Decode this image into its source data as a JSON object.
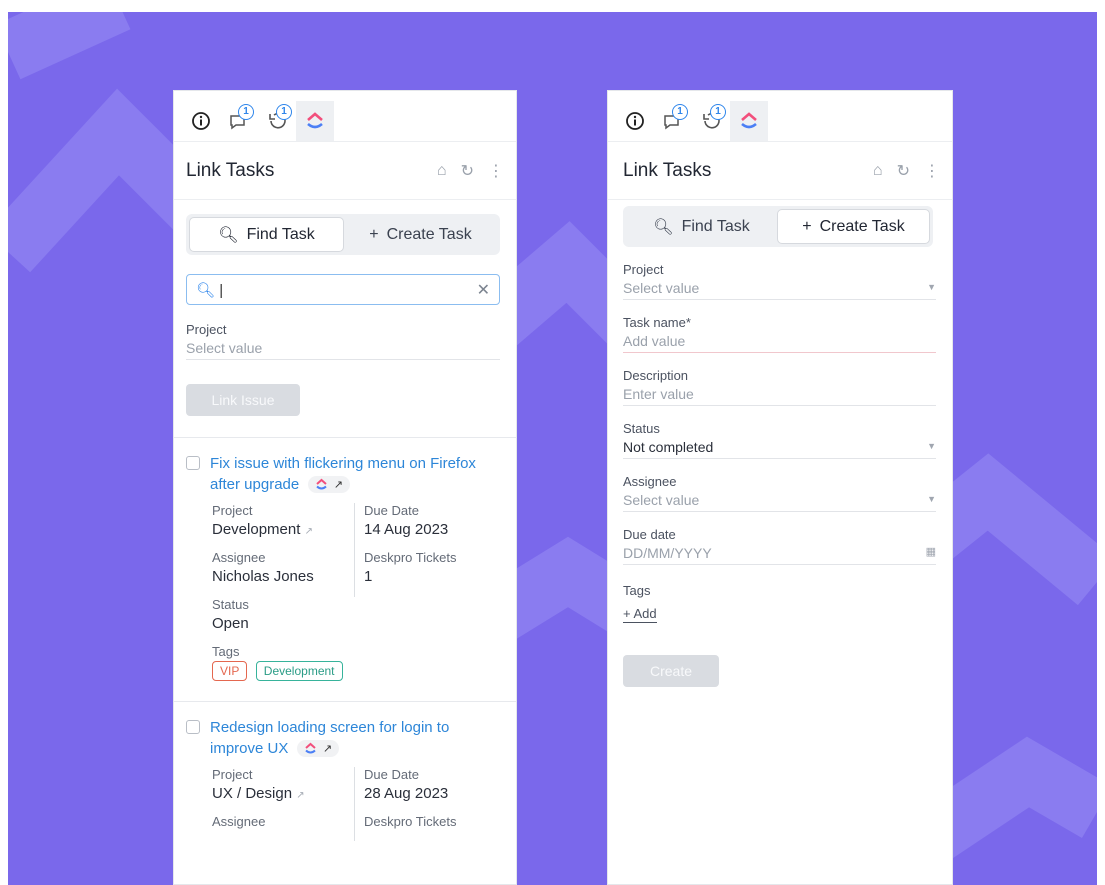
{
  "colors": {
    "background": "#7a68eb",
    "accent": "#2f86eb",
    "link": "#2d86d8",
    "tag_vip": "#e4674f",
    "tag_dev": "#37b39b"
  },
  "left_panel": {
    "icons": [
      {
        "name": "info-icon"
      },
      {
        "name": "chat-icon",
        "badge": "1"
      },
      {
        "name": "history-icon",
        "badge": "1"
      },
      {
        "name": "clickup-logo-icon"
      }
    ],
    "title": "Link Tasks",
    "tabs": {
      "find": "Find Task",
      "create": "Create Task",
      "selected": "find"
    },
    "search": {
      "value": "",
      "placeholder": ""
    },
    "project": {
      "label": "Project",
      "placeholder": "Select value"
    },
    "link_button": "Link Issue",
    "tasks": [
      {
        "title": "Fix issue with flickering menu on Firefox after upgrade",
        "project_label": "Project",
        "project": "Development",
        "due_label": "Due Date",
        "due": "14 Aug 2023",
        "assignee_label": "Assignee",
        "assignee": "Nicholas Jones",
        "tickets_label": "Deskpro Tickets",
        "tickets": "1",
        "status_label": "Status",
        "status": "Open",
        "tags_label": "Tags",
        "tags": [
          "VIP",
          "Development"
        ]
      },
      {
        "title": "Redesign loading screen for login to improve UX",
        "project_label": "Project",
        "project": "UX / Design",
        "due_label": "Due Date",
        "due": "28 Aug 2023",
        "assignee_label": "Assignee",
        "tickets_label": "Deskpro Tickets"
      }
    ]
  },
  "right_panel": {
    "title": "Link Tasks",
    "tabs": {
      "find": "Find Task",
      "create": "Create Task",
      "selected": "create"
    },
    "fields": [
      {
        "label": "Project",
        "value": "Select value",
        "placeholder": true,
        "dropdown": true
      },
      {
        "label": "Task name*",
        "value": "Add value",
        "placeholder": true,
        "dropdown": false
      },
      {
        "label": "Description",
        "value": "Enter value",
        "placeholder": true,
        "dropdown": false
      },
      {
        "label": "Status",
        "value": "Not completed",
        "placeholder": false,
        "dropdown": true
      },
      {
        "label": "Assignee",
        "value": "Select value",
        "placeholder": true,
        "dropdown": true
      },
      {
        "label": "Due date",
        "value": "DD/MM/YYYY",
        "placeholder": true,
        "dropdown": false
      }
    ],
    "tags_label": "Tags",
    "add_tag": "+ Add",
    "create_button": "Create"
  }
}
